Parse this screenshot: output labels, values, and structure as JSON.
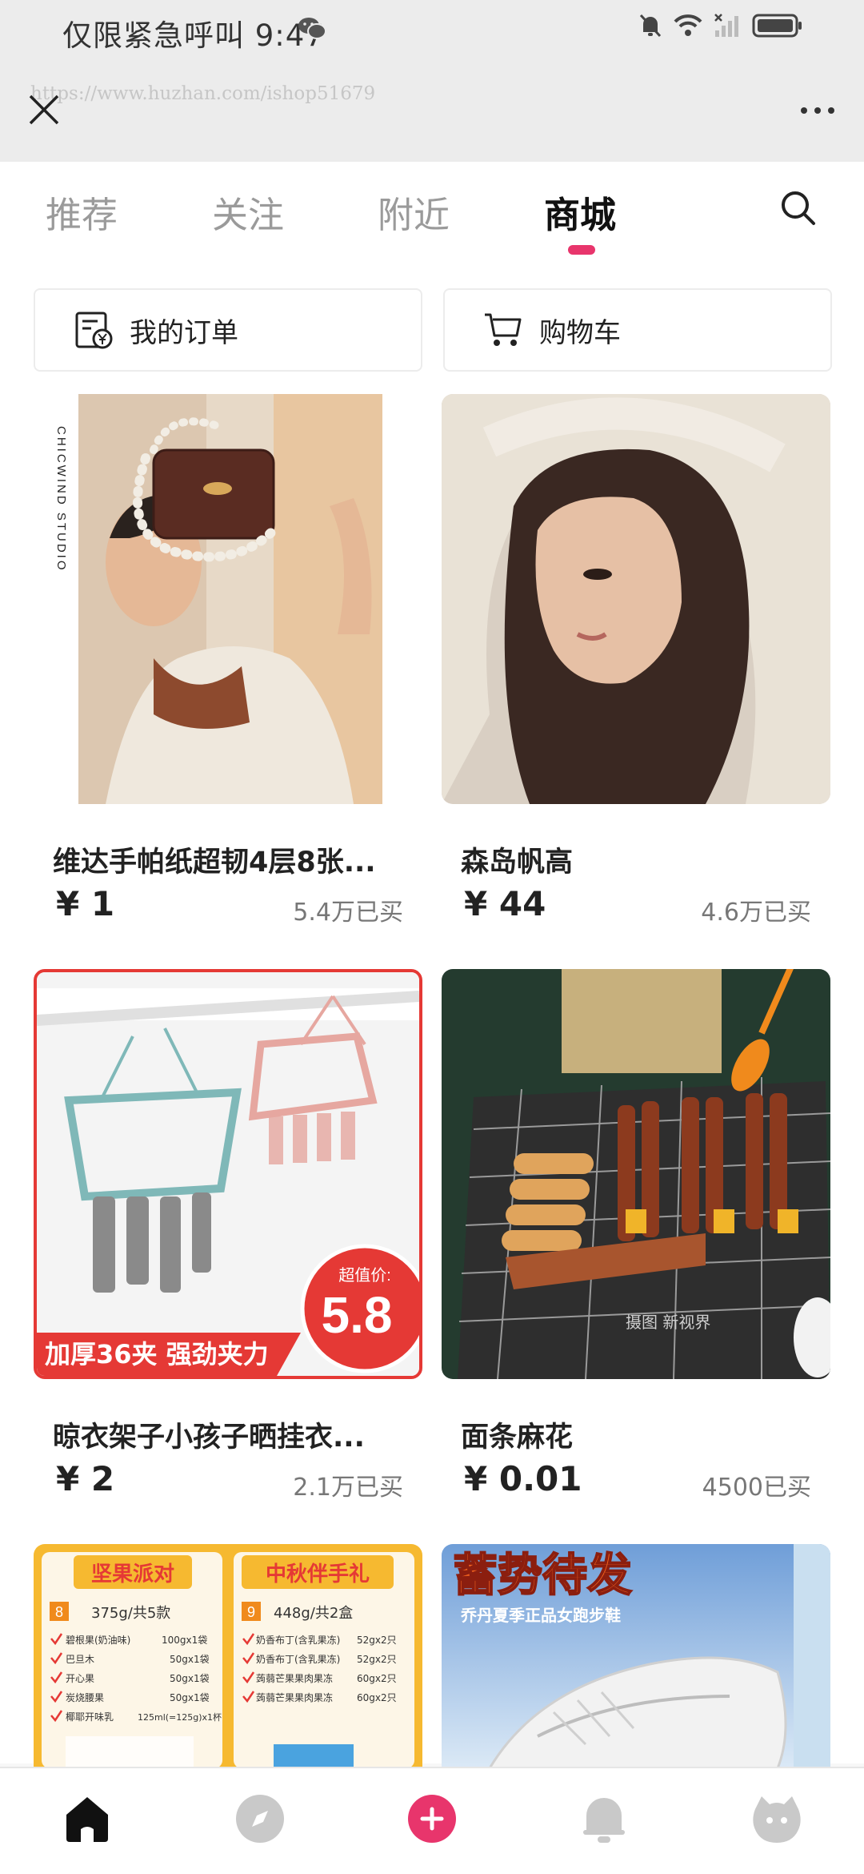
{
  "status_bar": {
    "time_text": "仅限紧急呼叫 9:47",
    "icons": [
      "wechat-icon",
      "mute-bell-icon",
      "wifi-icon",
      "no-signal-icon",
      "battery-icon"
    ]
  },
  "browser_bar": {
    "url_watermark": "https://www.huzhan.com/ishop51679",
    "close_icon": "close-icon",
    "more_icon": "more-dots-icon"
  },
  "tabs": [
    {
      "label": "推荐",
      "active": false
    },
    {
      "label": "关注",
      "active": false
    },
    {
      "label": "附近",
      "active": false
    },
    {
      "label": "商城",
      "active": true
    }
  ],
  "colors": {
    "accent": "#e8356c",
    "active_tab": "#111111",
    "inactive_tab": "#9a9a9a"
  },
  "quick_actions": [
    {
      "label": "我的订单",
      "icon": "order-receipt-icon"
    },
    {
      "label": "购物车",
      "icon": "cart-icon"
    }
  ],
  "products": [
    {
      "title": "维达手帕纸超韧4层8张...",
      "price": "¥ 1",
      "sold": "5.4万已买",
      "image_text": "CHICWIND STUDIO"
    },
    {
      "title": "森岛帆高",
      "price": "¥ 44",
      "sold": "4.6万已买"
    },
    {
      "title": "晾衣架子小孩子晒挂衣...",
      "price": "¥ 2",
      "sold": "2.1万已买",
      "banner_text": "加厚36夹 强劲夹力",
      "badge_label": "超值价:",
      "badge_price": "5.8"
    },
    {
      "title": "面条麻花",
      "price": "¥ 0.01",
      "sold": "4500已买",
      "image_text": "摄图 新视界"
    },
    {
      "partial": true,
      "headers": [
        "坚果派对",
        "中秋伴手礼"
      ],
      "box_left": {
        "num": "8",
        "spec": "375g/共5款",
        "items": [
          [
            "碧根果(奶油味)",
            "100gx1袋"
          ],
          [
            "巴旦木",
            "50gx1袋"
          ],
          [
            "开心果",
            "50gx1袋"
          ],
          [
            "炭烧腰果",
            "50gx1袋"
          ],
          [
            "椰耶开味乳",
            "125ml(=125g)x1杯"
          ]
        ]
      },
      "box_right": {
        "num": "9",
        "spec": "448g/共2盒",
        "items": [
          [
            "奶香布丁(含乳果冻)",
            "52gx2只"
          ],
          [
            "奶香布丁(含乳果冻)",
            "52gx2只"
          ],
          [
            "蒟蒻芒果果肉果冻",
            "60gx2只"
          ],
          [
            "蒟蒻芒果果肉果冻",
            "60gx2只"
          ]
        ]
      }
    },
    {
      "partial": true,
      "headline": "蓄势待发",
      "subline": "乔丹夏季正品女跑步鞋"
    }
  ],
  "bottom_nav": [
    {
      "icon": "home-icon",
      "active": true
    },
    {
      "icon": "compass-icon",
      "active": false
    },
    {
      "icon": "add-plus-icon",
      "active": false
    },
    {
      "icon": "notification-bell-icon",
      "active": false
    },
    {
      "icon": "profile-face-icon",
      "active": false
    }
  ]
}
